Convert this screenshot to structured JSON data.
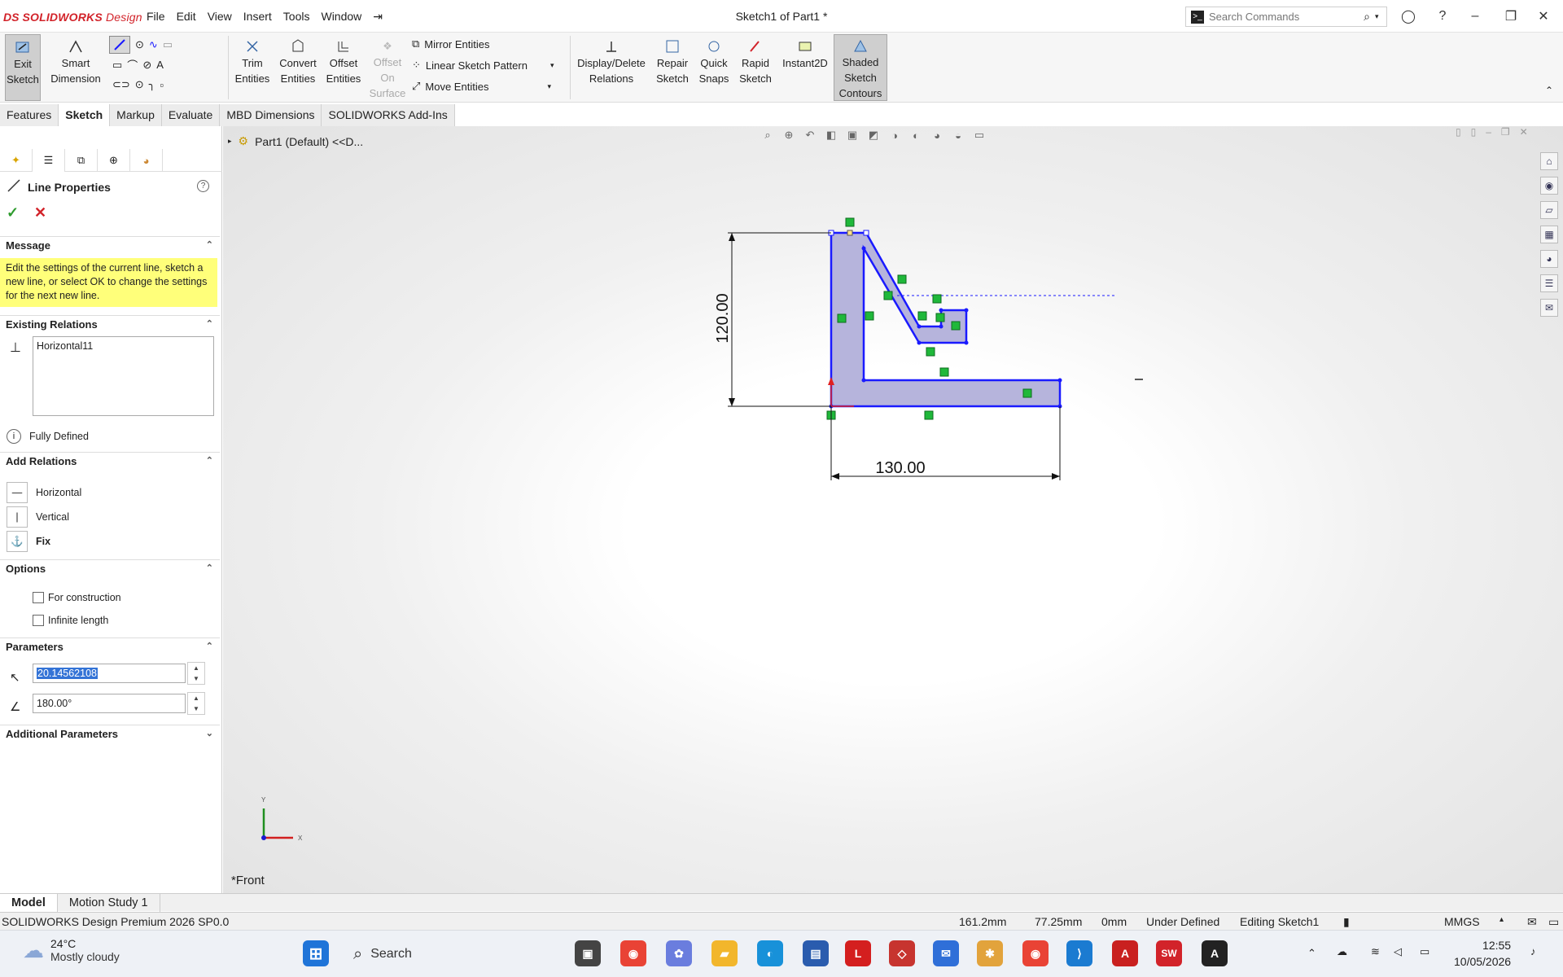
{
  "app": {
    "logo_ds": "DS",
    "brand_main": "SOLIDWORKS",
    "brand_sub": "Design",
    "title": "Sketch1 of Part1 *",
    "menus": [
      "File",
      "Edit",
      "View",
      "Insert",
      "Tools",
      "Window"
    ],
    "search_placeholder": "Search Commands"
  },
  "toolbar": {
    "exit_sketch": [
      "Exit",
      "Sketch"
    ],
    "smart_dimension": [
      "Smart",
      "Dimension"
    ],
    "trim": [
      "Trim",
      "Entities"
    ],
    "convert": [
      "Convert",
      "Entities"
    ],
    "offset": [
      "Offset",
      "Entities"
    ],
    "offset_surface": [
      "Offset",
      "On",
      "Surface"
    ],
    "mirror": "Mirror Entities",
    "linear_pattern": "Linear Sketch Pattern",
    "move": "Move Entities",
    "display_relations": [
      "Display/Delete",
      "Relations"
    ],
    "repair": [
      "Repair",
      "Sketch"
    ],
    "quick_snaps": [
      "Quick",
      "Snaps"
    ],
    "rapid_sketch": [
      "Rapid",
      "Sketch"
    ],
    "instant2d": "Instant2D",
    "shaded": [
      "Shaded",
      "Sketch",
      "Contours"
    ]
  },
  "tabs": [
    "Features",
    "Sketch",
    "Markup",
    "Evaluate",
    "MBD Dimensions",
    "SOLIDWORKS Add-Ins"
  ],
  "active_tab": "Sketch",
  "property_manager": {
    "title": "Line Properties",
    "message_header": "Message",
    "message": "Edit the settings of the current line, sketch a new line, or select OK to change the settings for the next new line.",
    "existing_header": "Existing Relations",
    "relations": [
      "Horizontal11"
    ],
    "status": "Fully Defined",
    "add_header": "Add Relations",
    "add_items": [
      "Horizontal",
      "Vertical",
      "Fix"
    ],
    "options_header": "Options",
    "options": [
      "For construction",
      "Infinite length"
    ],
    "params_header": "Parameters",
    "length_value": "20.14562108",
    "angle_value": "180.00°",
    "additional_header": "Additional Parameters"
  },
  "viewport": {
    "tree_root": "Part1 (Default) <<D...",
    "view_name": "*Front",
    "dim_vertical": "120.00",
    "dim_horizontal": "130.00",
    "axis_y": "Y",
    "axis_x": "X"
  },
  "model_tabs": [
    "Model",
    "Motion Study 1"
  ],
  "status": {
    "product": "SOLIDWORKS Design Premium 2026 SP0.0",
    "x": "161.2mm",
    "y": "77.25mm",
    "z": "0mm",
    "state": "Under Defined",
    "editing": "Editing Sketch1",
    "units": "MMGS"
  },
  "taskbar": {
    "temp": "24°C",
    "weather": "Mostly cloudy",
    "search": "Search",
    "time": "12:55",
    "date": "10/05/2026"
  },
  "colors": {
    "accent_red": "#d2232a",
    "sketch_blue": "#1a1aff",
    "shade": "#b6b4dc",
    "relation_green": "#1fb83a",
    "message_yellow": "#ffff7a"
  }
}
